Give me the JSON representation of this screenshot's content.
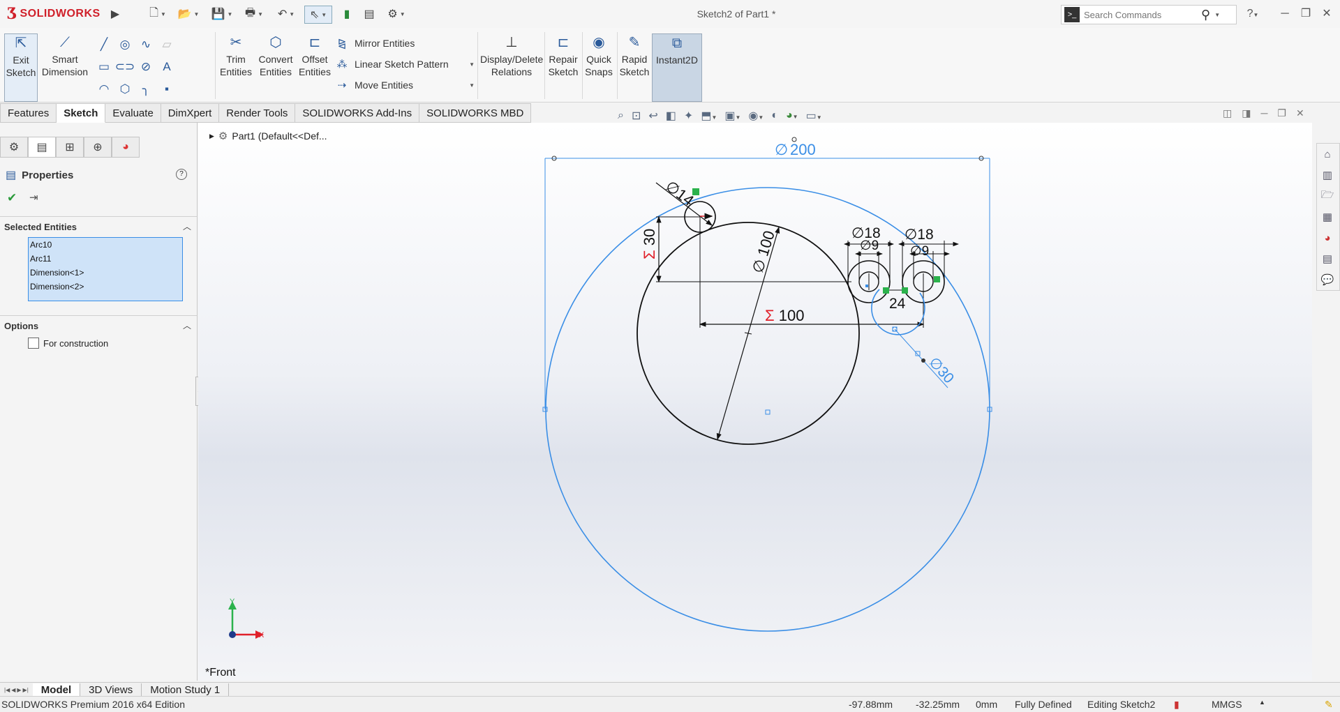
{
  "titlebar": {
    "logo_text": "SOLIDWORKS",
    "document_title": "Sketch2 of Part1 *",
    "search_placeholder": "Search Commands",
    "help_label": "?"
  },
  "ribbon": {
    "exit_sketch": "Exit Sketch",
    "smart_dimension": "Smart Dimension",
    "trim_entities": "Trim Entities",
    "convert_entities": "Convert Entities",
    "offset_entities": "Offset Entities",
    "mirror_entities": "Mirror Entities",
    "linear_sketch_pattern": "Linear Sketch Pattern",
    "move_entities": "Move Entities",
    "display_delete_relations": "Display/Delete Relations",
    "repair_sketch": "Repair Sketch",
    "quick_snaps": "Quick Snaps",
    "rapid_sketch": "Rapid Sketch",
    "instant2d": "Instant2D"
  },
  "tabs": [
    "Features",
    "Sketch",
    "Evaluate",
    "DimXpert",
    "Render Tools",
    "SOLIDWORKS Add-Ins",
    "SOLIDWORKS MBD"
  ],
  "active_tab": "Sketch",
  "panel": {
    "title": "Properties",
    "selected_entities_title": "Selected Entities",
    "selected_entities": [
      "Arc10",
      "Arc11",
      "Dimension<1>",
      "Dimension<2>"
    ],
    "options_title": "Options",
    "for_construction_label": "For construction",
    "for_construction_checked": false
  },
  "tree": {
    "root_label": "Part1  (Default<<Def..."
  },
  "sketch": {
    "dims": {
      "d200": "200",
      "d14": "14",
      "d100_diam": "100",
      "d30_vert": "30",
      "d100_horiz": "100",
      "d18_a": "18",
      "d9_a": "9",
      "d18_b": "18",
      "d9_b": "9",
      "d24": "24",
      "d30_arc": "30"
    },
    "view_label": "*Front",
    "axis_x": "X",
    "axis_y": "Y"
  },
  "bottom_tabs": [
    "Model",
    "3D Views",
    "Motion Study 1"
  ],
  "status": {
    "edition": "SOLIDWORKS Premium 2016 x64 Edition",
    "x": "-97.88mm",
    "y": "-32.25mm",
    "z": "0mm",
    "state": "Fully Defined",
    "editing": "Editing Sketch2",
    "units": "MMGS"
  },
  "colors": {
    "accent_blue": "#3a8ee6",
    "sketch_black": "#111111",
    "dim_red": "#e0202a",
    "brand_red": "#d0202a"
  }
}
